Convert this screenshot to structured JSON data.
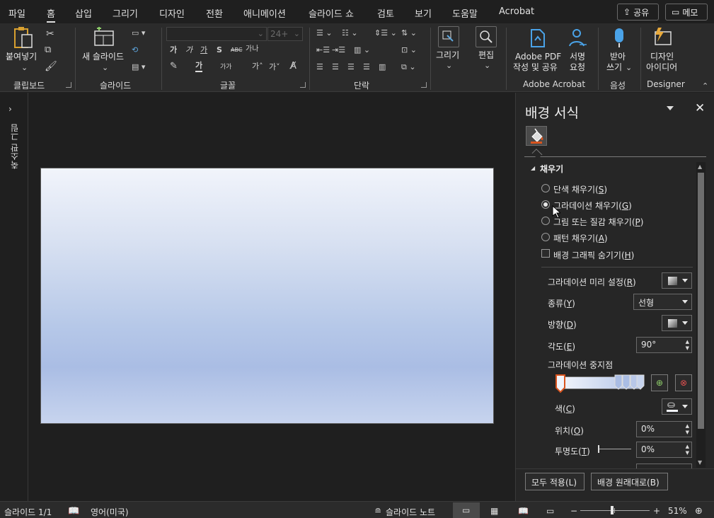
{
  "menubar": {
    "tabs": [
      "파일",
      "홈",
      "삽입",
      "그리기",
      "디자인",
      "전환",
      "애니메이션",
      "슬라이드 쇼",
      "검토",
      "보기",
      "도움말",
      "Acrobat"
    ],
    "share_label": "공유",
    "memo_label": "메모"
  },
  "ribbon": {
    "clipboard": {
      "paste_label": "붙여넣기",
      "group_label": "클립보드"
    },
    "slides": {
      "new_slide_label": "새 슬라이드",
      "group_label": "슬라이드"
    },
    "font": {
      "font_name": "",
      "font_size": "24+",
      "group_label": "글꼴",
      "small_letters": [
        "가",
        "가",
        "가",
        "S",
        "ABC",
        "가나"
      ],
      "case_label": "가가",
      "grow_label": "가˄",
      "shrink_label": "가˅"
    },
    "paragraph": {
      "group_label": "단락"
    },
    "draw": {
      "label": "그리기"
    },
    "edit": {
      "label": "편집"
    },
    "acrobat": {
      "pdf_label_1": "Adobe PDF",
      "pdf_label_2": "작성 및 공유",
      "sign_label_1": "서명",
      "sign_label_2": "요청",
      "group_label": "Adobe Acrobat"
    },
    "voice": {
      "dictate_label_1": "받아",
      "dictate_label_2": "쓰기",
      "group_label": "음성"
    },
    "designer": {
      "label_1": "디자인",
      "label_2": "아이디어",
      "group_label": "Designer"
    }
  },
  "thumbs": {
    "label": "축소판 그림"
  },
  "pane": {
    "title": "배경 서식",
    "section": "채우기",
    "fill_options": [
      {
        "label": "단색 채우기",
        "key": "S",
        "checked": false
      },
      {
        "label": "그라데이션 채우기",
        "key": "G",
        "checked": true
      },
      {
        "label": "그림 또는 질감 채우기",
        "key": "P",
        "checked": false
      },
      {
        "label": "패턴 채우기",
        "key": "A",
        "checked": false
      }
    ],
    "hide_graphics": {
      "label": "배경 그래픽 숨기기",
      "key": "H",
      "checked": false
    },
    "preset": {
      "label": "그라데이션 미리 설정",
      "key": "R"
    },
    "type": {
      "label": "종류",
      "key": "Y",
      "value": "선형"
    },
    "direction": {
      "label": "방향",
      "key": "D"
    },
    "angle": {
      "label": "각도",
      "key": "E",
      "value": "90°"
    },
    "stops": {
      "label": "그라데이션 중지점"
    },
    "color": {
      "label": "색",
      "key": "C"
    },
    "position": {
      "label": "위치",
      "key": "O",
      "value": "0%"
    },
    "transparency": {
      "label": "투명도",
      "key": "T",
      "value": "0%"
    },
    "apply_all": "모두 적용(L)",
    "reset": "배경 원래대로(B)"
  },
  "status": {
    "slide": "슬라이드 1/1",
    "language": "영어(미국)",
    "notes": "슬라이드 노트",
    "zoom": "51%",
    "zoom_fraction": 0.46
  }
}
